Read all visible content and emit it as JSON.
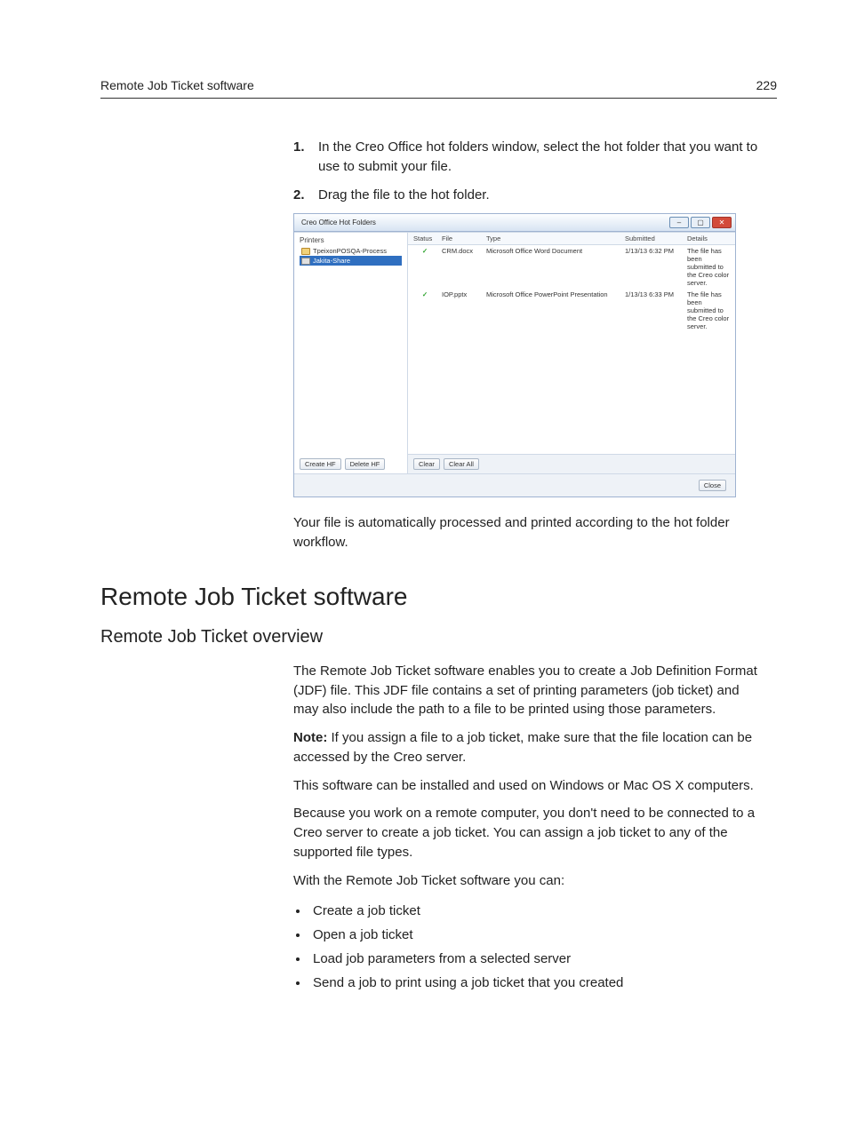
{
  "header": {
    "left": "Remote Job Ticket software",
    "right": "229"
  },
  "steps": [
    {
      "num": "1.",
      "text": "In the Creo Office hot folders window, select the hot folder that you want to use to submit your file."
    },
    {
      "num": "2.",
      "text": "Drag the file to the hot folder."
    }
  ],
  "screenshot": {
    "window_title": "Creo Office Hot Folders",
    "left_heading": "Printers",
    "printers": [
      {
        "name": "TpeixonPOSQA-Process",
        "kind": "folder",
        "selected": false
      },
      {
        "name": "Jakita-Share",
        "kind": "server",
        "selected": true
      }
    ],
    "buttons_left": {
      "create": "Create HF",
      "delete": "Delete HF"
    },
    "columns": {
      "status": "Status",
      "file": "File",
      "type": "Type",
      "submitted": "Submitted",
      "details": "Details"
    },
    "rows": [
      {
        "status": "✓",
        "file": "CRM.docx",
        "type": "Microsoft Office Word Document",
        "submitted": "1/13/13 6:32 PM",
        "details": "The file has been submitted to the Creo color server."
      },
      {
        "status": "✓",
        "file": "IOP.pptx",
        "type": "Microsoft Office PowerPoint Presentation",
        "submitted": "1/13/13 6:33 PM",
        "details": "The file has been submitted to the Creo color server."
      }
    ],
    "buttons_right": {
      "clear": "Clear",
      "clear_all": "Clear All"
    },
    "footer_close": "Close"
  },
  "post_screenshot": "Your file is automatically processed and printed according to the hot folder workflow.",
  "heading_main": "Remote Job Ticket software",
  "heading_sub": "Remote Job Ticket overview",
  "paragraphs": {
    "p1": "The Remote Job Ticket software enables you to create a Job Definition Format (JDF) file. This JDF file contains a set of printing parameters (job ticket) and may also include the path to a file to be printed using those parameters.",
    "note_label": "Note:",
    "note_body": " If you assign a file to a job ticket, make sure that the file location can be accessed by the Creo server.",
    "p2": "This software can be installed and used on Windows or Mac OS X computers.",
    "p3": "Because you work on a remote computer, you don't need to be connected to a Creo server to create a job ticket. You can assign a job ticket to any of the supported file types.",
    "p4": "With the Remote Job Ticket software you can:"
  },
  "features": [
    "Create a job ticket",
    "Open a job ticket",
    "Load job parameters from a selected server",
    "Send a job to print using a job ticket that you created"
  ]
}
